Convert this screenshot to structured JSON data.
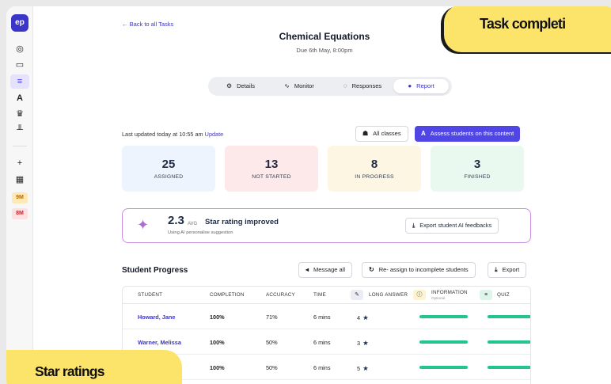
{
  "sidebar": {
    "logo": "ep",
    "badges": [
      "9M",
      "8M"
    ]
  },
  "header": {
    "back_link": "← Back to all Tasks",
    "title": "Chemical Equations",
    "due": "Due 6th May, 8:00pm"
  },
  "tabs": [
    {
      "label": "Details",
      "icon": "gear-icon"
    },
    {
      "label": "Monitor",
      "icon": "pulse-icon"
    },
    {
      "label": "Responses",
      "icon": "chat-icon"
    },
    {
      "label": "Report",
      "icon": "pie-chart-icon",
      "active": true
    }
  ],
  "toolbar": {
    "updated_text": "Last updated today at 10:55 am",
    "update_link": "Update",
    "all_classes": "All classes",
    "assess_button": "Assess students on this content"
  },
  "stats": [
    {
      "value": "25",
      "label": "ASSIGNED",
      "color": "#eef4fd"
    },
    {
      "value": "13",
      "label": "NOT STARTED",
      "color": "#fde9e9"
    },
    {
      "value": "8",
      "label": "IN PROGRESS",
      "color": "#fdf6e3"
    },
    {
      "value": "3",
      "label": "FINISHED",
      "color": "#e9f9ef"
    }
  ],
  "ai_card": {
    "value": "2.3",
    "avg": "AVG",
    "label": "Star rating improved",
    "sub": "Using AI personalise suggestion",
    "export": "Export student AI feedbacks"
  },
  "student_progress": {
    "title": "Student Progress",
    "message_all": "Message all",
    "reassign": "Re- assign to incomplete students",
    "export": "Export",
    "columns": [
      "STUDENT",
      "COMPLETION",
      "ACCURACY",
      "TIME",
      "LONG ANSWER",
      "INFORMATION",
      "QUIZ"
    ],
    "information_sub": "Optional",
    "rows": [
      {
        "name": "Howard, Jane",
        "completion": "100%",
        "accuracy": "71%",
        "time": "6 mins",
        "stars": "4"
      },
      {
        "name": "Warner, Melissa",
        "completion": "100%",
        "accuracy": "50%",
        "time": "6 mins",
        "stars": "3"
      },
      {
        "name": "",
        "completion": "100%",
        "accuracy": "50%",
        "time": "6 mins",
        "stars": "5"
      }
    ]
  },
  "banners": {
    "task": "Task completi",
    "star": "Star ratings"
  },
  "colors": {
    "accent": "#4f46e5",
    "progress": "#22c58b",
    "banner": "#fce46b"
  }
}
